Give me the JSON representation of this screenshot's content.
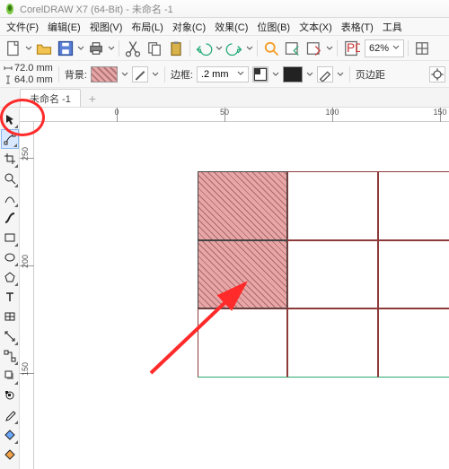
{
  "title": "CorelDRAW X7 (64-Bit) - 未命名 -1",
  "menu": {
    "file": "文件(F)",
    "edit": "编辑(E)",
    "view": "视图(V)",
    "layout": "布局(L)",
    "object": "对象(C)",
    "effect": "效果(C)",
    "bitmap": "位图(B)",
    "text": "文本(X)",
    "table": "表格(T)",
    "tools": "工具"
  },
  "toolbar": {
    "zoom": "62%"
  },
  "propbar": {
    "width": "72.0 mm",
    "height": "64.0 mm",
    "bg_label": "背景:",
    "border_label": "边框:",
    "border_width": ".2 mm",
    "page_margin_label": "页边距"
  },
  "doc_tab": {
    "name": "未命名 -1"
  },
  "ruler": {
    "ticks_h": [
      "0",
      "50",
      "100",
      "150"
    ],
    "ticks_v": [
      "250",
      "200",
      "150"
    ]
  }
}
